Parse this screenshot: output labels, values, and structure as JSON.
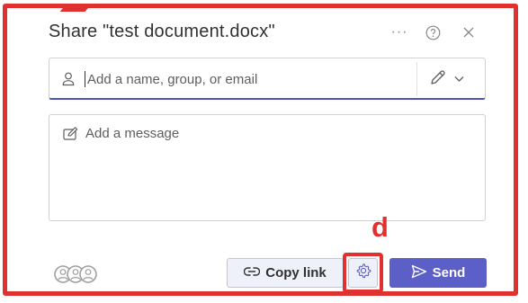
{
  "dialog": {
    "title": "Share \"test document.docx\"",
    "more_icon": "more-horizontal-icon",
    "help_icon": "help-icon",
    "close_icon": "close-icon"
  },
  "recipients": {
    "placeholder": "Add a name, group, or email",
    "person_icon": "person-icon",
    "permission_icon": "pencil-edit-icon",
    "permission_dropdown_icon": "chevron-down-icon"
  },
  "message": {
    "placeholder": "Add a message",
    "icon": "message-edit-icon"
  },
  "footer": {
    "copy_link_label": "Copy link",
    "copy_link_icon": "link-icon",
    "settings_icon": "gear-icon",
    "send_label": "Send",
    "send_icon": "send-icon",
    "avatars_icon": "people-avatars-icon"
  },
  "annotation": {
    "label": "d",
    "color": "#e03131"
  },
  "colors": {
    "accent": "#5b5fc7",
    "secondary_button_bg": "#eef0fa",
    "text": "#323130",
    "annotation": "#e03131"
  }
}
